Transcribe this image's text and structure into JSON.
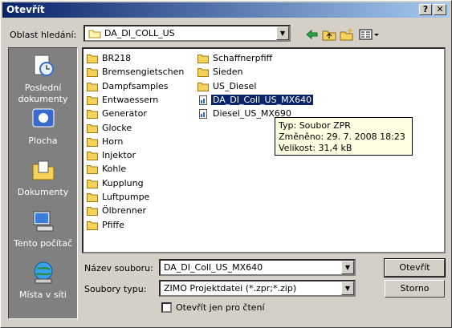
{
  "window": {
    "title": "Otevřít",
    "help_label": "?",
    "close_label": "✕"
  },
  "lookin": {
    "label": "Oblast hledání:",
    "value": "DA_DI_COLL_US"
  },
  "toolbar": {
    "icons": [
      "back-icon",
      "up-folder-icon",
      "new-folder-icon",
      "view-menu-icon"
    ]
  },
  "places": [
    {
      "label": "Poslední dokumenty",
      "icon": "recent-documents-icon"
    },
    {
      "label": "Plocha",
      "icon": "desktop-icon"
    },
    {
      "label": "Dokumenty",
      "icon": "my-documents-icon"
    },
    {
      "label": "Tento počítač",
      "icon": "my-computer-icon"
    },
    {
      "label": "Místa v síti",
      "icon": "network-places-icon"
    }
  ],
  "files": {
    "col1": [
      "BR218",
      "Bremsengietschen",
      "Dampfsamples",
      "Entwaessern",
      "Generator",
      "Glocke",
      "Horn",
      "Injektor",
      "Kohle",
      "Kupplung",
      "Luftpumpe",
      "Ölbrenner",
      "Pfiffe"
    ],
    "col2": [
      {
        "name": "Schaffnerpfiff",
        "type": "folder"
      },
      {
        "name": "Sieden",
        "type": "folder"
      },
      {
        "name": "US_Diesel",
        "type": "folder"
      },
      {
        "name": "DA_DI_Coll_US_MX640",
        "type": "file",
        "selected": true
      },
      {
        "name": "Diesel_US_MX690",
        "type": "file"
      }
    ]
  },
  "tooltip": {
    "type": "Typ: Soubor ZPR",
    "modified": "Změněno: 29. 7. 2008 18:23",
    "size": "Velikost: 31,4 kB"
  },
  "filename": {
    "label": "Název souboru:",
    "value": "DA_DI_Coll_US_MX640"
  },
  "filetype": {
    "label": "Soubory typu:",
    "value": "ZIMO Projektdatei (*.zpr;*.zip)"
  },
  "readonly": {
    "label": "Otevřít jen pro čtení",
    "checked": false
  },
  "buttons": {
    "open": "Otevřít",
    "cancel": "Storno"
  }
}
